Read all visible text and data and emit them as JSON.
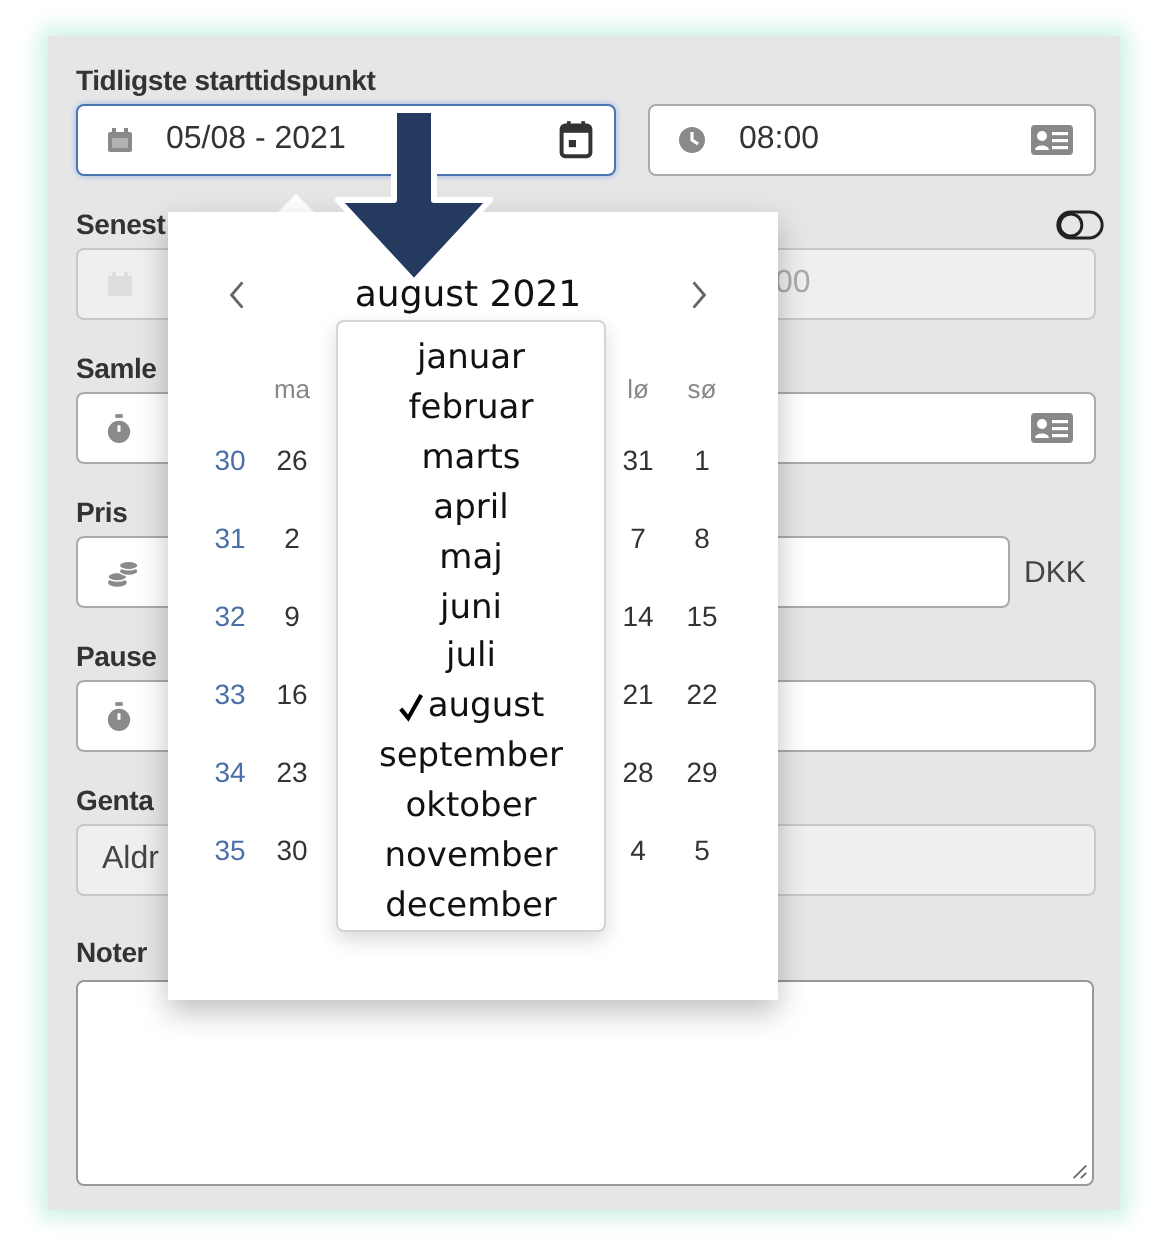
{
  "earliest_start": {
    "label": "Tidligste starttidspunkt",
    "date_value": "05/08 - 2021",
    "date_focused": true,
    "time_value": "08:00"
  },
  "latest_start": {
    "label": "Senest",
    "disabled": true,
    "time_value": "00"
  },
  "total": {
    "label": "Samle"
  },
  "price": {
    "label": "Pris",
    "unit": "DKK"
  },
  "pause": {
    "label": "Pause"
  },
  "repeat": {
    "label": "Genta",
    "value": "Aldr",
    "disabled": true
  },
  "notes": {
    "label": "Noter"
  },
  "datepicker": {
    "title": "august 2021",
    "weekdays": [
      "ma",
      "lø",
      "sø"
    ],
    "weeks": [
      {
        "number": "30",
        "days": [
          "26",
          "31",
          "1"
        ]
      },
      {
        "number": "31",
        "days": [
          "2",
          "7",
          "8"
        ]
      },
      {
        "number": "32",
        "days": [
          "9",
          "14",
          "15"
        ]
      },
      {
        "number": "33",
        "days": [
          "16",
          "21",
          "22"
        ]
      },
      {
        "number": "34",
        "days": [
          "23",
          "28",
          "29"
        ]
      },
      {
        "number": "35",
        "days": [
          "30",
          "4",
          "5"
        ]
      }
    ]
  },
  "month_menu": [
    {
      "label": "januar",
      "selected": false
    },
    {
      "label": "februar",
      "selected": false
    },
    {
      "label": "marts",
      "selected": false
    },
    {
      "label": "april",
      "selected": false
    },
    {
      "label": "maj",
      "selected": false
    },
    {
      "label": "juni",
      "selected": false
    },
    {
      "label": "juli",
      "selected": false
    },
    {
      "label": "august",
      "selected": true
    },
    {
      "label": "september",
      "selected": false
    },
    {
      "label": "oktober",
      "selected": false
    },
    {
      "label": "november",
      "selected": false
    },
    {
      "label": "december",
      "selected": false
    }
  ]
}
